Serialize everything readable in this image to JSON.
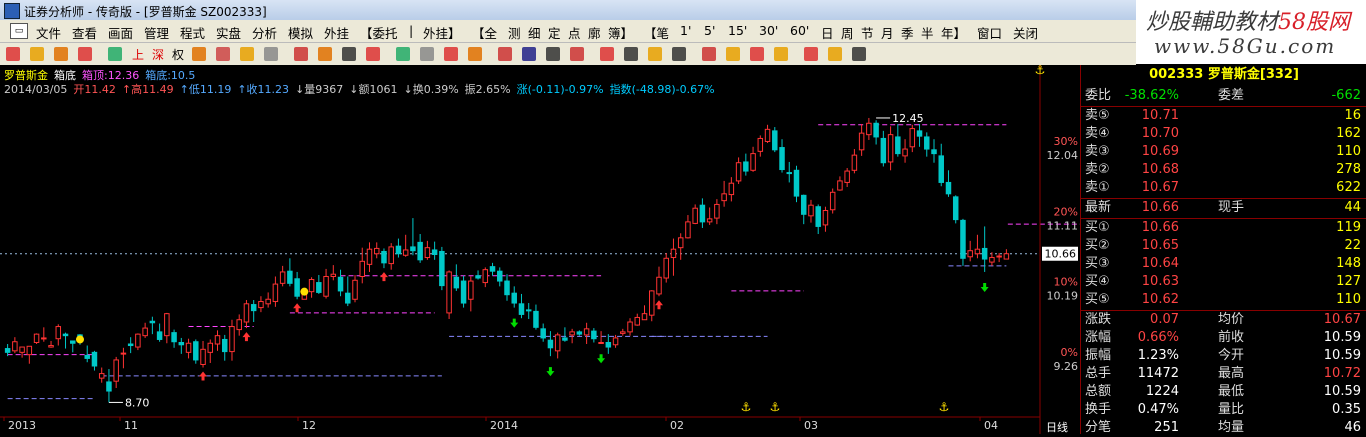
{
  "window": {
    "title": "证券分析师 - 传奇版 - [罗普斯金 SZ002333]"
  },
  "brand": {
    "text_a": "炒股輔助教材",
    "text_b": "58股网",
    "url": "www.58Gu.com"
  },
  "menu": [
    "文件",
    "查看",
    "画面",
    "管理",
    "程式",
    "实盘",
    "分析",
    "模拟",
    "外挂",
    "【委托",
    "|",
    "外挂】",
    "【全",
    "测",
    "细",
    "定",
    "点",
    "廓",
    "簿】",
    "【笔",
    "1'",
    "5'",
    "15'",
    "30'",
    "60'",
    "日",
    "周",
    "节",
    "月",
    "季",
    "半",
    "年】",
    "窗口",
    "关闭"
  ],
  "toolbar": {
    "labels": [
      "上",
      "深",
      "权"
    ]
  },
  "info": {
    "line1": [
      {
        "t": "罗普斯金",
        "c": "#ffff00"
      },
      {
        "t": "箱底",
        "c": "#ffffff"
      },
      {
        "t": "箱顶:12.36",
        "c": "#ff55ff"
      },
      {
        "t": "箱底:10.5",
        "c": "#55aaff"
      }
    ],
    "line2": [
      {
        "t": "2014/03/05",
        "c": "#cccccc"
      },
      {
        "t": "开11.42",
        "c": "#ff5555"
      },
      {
        "t": "↑高11.49",
        "c": "#ff5555"
      },
      {
        "t": "↑低11.19",
        "c": "#55aaff"
      },
      {
        "t": "↑收11.23",
        "c": "#55aaff"
      },
      {
        "t": "↓量9367",
        "c": "#cccccc"
      },
      {
        "t": "↓额1061",
        "c": "#cccccc"
      },
      {
        "t": "↓换0.39%",
        "c": "#cccccc"
      },
      {
        "t": "振2.65%",
        "c": "#cccccc"
      },
      {
        "t": "涨(-0.11)-0.97%",
        "c": "#00ccff"
      },
      {
        "t": "指数(-48.98)-0.67%",
        "c": "#00ccff"
      }
    ]
  },
  "axis": {
    "right_labels": [
      {
        "pct": "30%",
        "price": "12.04"
      },
      {
        "pct": "20%",
        "price": "11.11"
      },
      {
        "pct": "10%",
        "price": "10.19"
      },
      {
        "pct": "0%",
        "price": "9.26"
      }
    ],
    "current_price": "10.66",
    "high_label": "12.45",
    "low_label": "8.70",
    "x_labels": [
      {
        "t": "2013",
        "x": 4
      },
      {
        "t": "11",
        "x": 120
      },
      {
        "t": "12",
        "x": 298
      },
      {
        "t": "2014",
        "x": 486
      },
      {
        "t": "02",
        "x": 666
      },
      {
        "t": "03",
        "x": 800
      },
      {
        "t": "04",
        "x": 980
      }
    ],
    "period": "日线"
  },
  "quote": {
    "header": "002333 罗普斯金[332]",
    "weibi": {
      "l": "委比",
      "v": "-38.62%",
      "l2": "委差",
      "v2": "-662"
    },
    "asks": [
      {
        "l": "卖⑤",
        "p": "10.71",
        "v": "16"
      },
      {
        "l": "卖④",
        "p": "10.70",
        "v": "162"
      },
      {
        "l": "卖③",
        "p": "10.69",
        "v": "110"
      },
      {
        "l": "卖②",
        "p": "10.68",
        "v": "278"
      },
      {
        "l": "卖①",
        "p": "10.67",
        "v": "622"
      }
    ],
    "last": {
      "l": "最新",
      "p": "10.66",
      "l2": "现手",
      "v": "44"
    },
    "bids": [
      {
        "l": "买①",
        "p": "10.66",
        "v": "119"
      },
      {
        "l": "买②",
        "p": "10.65",
        "v": "22"
      },
      {
        "l": "买③",
        "p": "10.64",
        "v": "148"
      },
      {
        "l": "买④",
        "p": "10.63",
        "v": "127"
      },
      {
        "l": "买⑤",
        "p": "10.62",
        "v": "110"
      }
    ],
    "stats": [
      {
        "l": "涨跌",
        "v": "0.07",
        "vc": "red",
        "l2": "均价",
        "v2": "10.67",
        "v2c": "red"
      },
      {
        "l": "涨幅",
        "v": "0.66%",
        "vc": "red",
        "l2": "前收",
        "v2": "10.59",
        "v2c": "wht"
      },
      {
        "l": "振幅",
        "v": "1.23%",
        "vc": "wht",
        "l2": "今开",
        "v2": "10.59",
        "v2c": "wht"
      },
      {
        "l": "总手",
        "v": "11472",
        "vc": "wht",
        "l2": "最高",
        "v2": "10.72",
        "v2c": "red"
      },
      {
        "l": "总额",
        "v": "1224",
        "vc": "wht",
        "l2": "最低",
        "v2": "10.59",
        "v2c": "wht"
      },
      {
        "l": "换手",
        "v": "0.47%",
        "vc": "wht",
        "l2": "量比",
        "v2": "0.35",
        "v2c": "wht"
      },
      {
        "l": "分笔",
        "v": "251",
        "vc": "wht",
        "l2": "均量",
        "v2": "46",
        "v2c": "wht"
      }
    ]
  },
  "colors": {
    "up": "#ff3333",
    "down": "#00c8c8",
    "box_top": "#ff44ff",
    "box_bottom": "#8888ff"
  },
  "chart_data": {
    "type": "candlestick",
    "y_range": [
      8.6,
      12.7
    ],
    "candles": [
      [
        9.41,
        9.47,
        9.31,
        9.36
      ],
      [
        9.38,
        9.56,
        9.35,
        9.5
      ],
      [
        9.36,
        9.43,
        9.29,
        9.43
      ],
      [
        9.33,
        9.44,
        9.21,
        9.44
      ],
      [
        9.49,
        9.61,
        9.47,
        9.6
      ],
      [
        9.54,
        9.69,
        9.5,
        9.55
      ],
      [
        9.43,
        9.51,
        9.42,
        9.45
      ],
      [
        9.54,
        9.73,
        9.45,
        9.7
      ],
      [
        9.6,
        9.62,
        9.41,
        9.58
      ],
      [
        9.51,
        9.51,
        9.36,
        9.48
      ],
      [
        9.59,
        9.6,
        9.46,
        9.53
      ],
      [
        9.32,
        9.45,
        9.23,
        9.28
      ],
      [
        9.36,
        9.38,
        9.12,
        9.18
      ],
      [
        9.02,
        9.16,
        8.96,
        9.08
      ],
      [
        8.97,
        9.14,
        8.7,
        8.85
      ],
      [
        8.98,
        9.3,
        8.89,
        9.26
      ],
      [
        9.34,
        9.42,
        9.15,
        9.35
      ],
      [
        9.47,
        9.56,
        9.35,
        9.45
      ],
      [
        9.43,
        9.61,
        9.39,
        9.6
      ],
      [
        9.58,
        9.75,
        9.55,
        9.68
      ],
      [
        9.77,
        9.83,
        9.6,
        9.75
      ],
      [
        9.63,
        9.74,
        9.5,
        9.53
      ],
      [
        9.58,
        9.88,
        9.48,
        9.87
      ],
      [
        9.62,
        9.66,
        9.42,
        9.5
      ],
      [
        9.49,
        9.55,
        9.34,
        9.46
      ],
      [
        9.36,
        9.54,
        9.28,
        9.48
      ],
      [
        9.5,
        9.53,
        9.21,
        9.26
      ],
      [
        9.2,
        9.51,
        9.16,
        9.4
      ],
      [
        9.36,
        9.53,
        9.22,
        9.48
      ],
      [
        9.47,
        9.65,
        9.38,
        9.58
      ],
      [
        9.53,
        9.59,
        9.25,
        9.37
      ],
      [
        9.37,
        9.79,
        9.25,
        9.7
      ],
      [
        9.66,
        9.86,
        9.58,
        9.79
      ],
      [
        9.76,
        10.05,
        9.68,
        10.0
      ],
      [
        9.99,
        10.05,
        9.76,
        9.91
      ],
      [
        9.95,
        10.1,
        9.89,
        10.03
      ],
      [
        10.0,
        10.15,
        9.95,
        10.06
      ],
      [
        10.03,
        10.36,
        9.96,
        10.26
      ],
      [
        10.27,
        10.5,
        10.23,
        10.42
      ],
      [
        10.43,
        10.6,
        10.23,
        10.27
      ],
      [
        10.33,
        10.42,
        10.06,
        10.1
      ],
      [
        10.06,
        10.19,
        10.06,
        10.16
      ],
      [
        10.16,
        10.35,
        10.08,
        10.32
      ],
      [
        10.28,
        10.38,
        10.13,
        10.15
      ],
      [
        10.1,
        10.46,
        10.07,
        10.36
      ],
      [
        10.36,
        10.51,
        10.31,
        10.39
      ],
      [
        10.35,
        10.45,
        10.1,
        10.17
      ],
      [
        10.14,
        10.36,
        9.97,
        10.01
      ],
      [
        10.06,
        10.38,
        10.02,
        10.31
      ],
      [
        10.36,
        10.74,
        10.27,
        10.56
      ],
      [
        10.52,
        10.81,
        10.42,
        10.72
      ],
      [
        10.66,
        10.81,
        10.6,
        10.73
      ],
      [
        10.69,
        10.73,
        10.47,
        10.54
      ],
      [
        10.53,
        10.8,
        10.45,
        10.75
      ],
      [
        10.76,
        10.86,
        10.61,
        10.66
      ],
      [
        10.64,
        10.91,
        10.62,
        10.71
      ],
      [
        10.75,
        11.13,
        10.64,
        10.7
      ],
      [
        10.81,
        10.92,
        10.54,
        10.58
      ],
      [
        10.61,
        10.83,
        10.58,
        10.74
      ],
      [
        10.71,
        10.82,
        10.58,
        10.65
      ],
      [
        10.69,
        10.75,
        10.18,
        10.24
      ],
      [
        9.88,
        10.44,
        9.8,
        10.42
      ],
      [
        10.35,
        10.52,
        10.17,
        10.21
      ],
      [
        10.3,
        10.37,
        9.95,
        10.01
      ],
      [
        10.06,
        10.36,
        9.9,
        10.3
      ],
      [
        10.37,
        10.44,
        10.32,
        10.34
      ],
      [
        10.28,
        10.48,
        10.22,
        10.45
      ],
      [
        10.49,
        10.54,
        10.37,
        10.43
      ],
      [
        10.43,
        10.48,
        10.23,
        10.3
      ],
      [
        10.3,
        10.39,
        10.04,
        10.12
      ],
      [
        10.14,
        10.23,
        9.95,
        10.01
      ],
      [
        10.0,
        10.13,
        9.81,
        9.86
      ],
      [
        9.92,
        10.01,
        9.8,
        9.91
      ],
      [
        9.9,
        9.99,
        9.66,
        9.69
      ],
      [
        9.67,
        9.74,
        9.5,
        9.55
      ],
      [
        9.52,
        9.64,
        9.31,
        9.42
      ],
      [
        9.38,
        9.62,
        9.28,
        9.59
      ],
      [
        9.55,
        9.69,
        9.5,
        9.52
      ],
      [
        9.59,
        9.67,
        9.48,
        9.63
      ],
      [
        9.63,
        9.65,
        9.58,
        9.6
      ],
      [
        9.59,
        9.75,
        9.47,
        9.67
      ],
      [
        9.64,
        9.68,
        9.49,
        9.54
      ],
      [
        9.49,
        9.64,
        9.48,
        9.49
      ],
      [
        9.49,
        9.6,
        9.34,
        9.43
      ],
      [
        9.46,
        9.59,
        9.42,
        9.55
      ],
      [
        9.61,
        9.67,
        9.58,
        9.63
      ],
      [
        9.63,
        9.81,
        9.58,
        9.76
      ],
      [
        9.72,
        9.87,
        9.71,
        9.82
      ],
      [
        9.79,
        9.98,
        9.79,
        9.87
      ],
      [
        9.85,
        10.18,
        9.77,
        10.17
      ],
      [
        10.13,
        10.49,
        10.1,
        10.35
      ],
      [
        10.34,
        10.67,
        10.28,
        10.6
      ],
      [
        10.61,
        10.86,
        10.37,
        10.72
      ],
      [
        10.74,
        10.93,
        10.58,
        10.87
      ],
      [
        10.87,
        11.17,
        10.86,
        11.08
      ],
      [
        11.06,
        11.31,
        11.05,
        11.26
      ],
      [
        11.3,
        11.39,
        11.0,
        11.08
      ],
      [
        11.08,
        11.27,
        11.04,
        11.12
      ],
      [
        11.13,
        11.38,
        11.05,
        11.31
      ],
      [
        11.36,
        11.62,
        11.28,
        11.45
      ],
      [
        11.44,
        11.67,
        11.35,
        11.59
      ],
      [
        11.62,
        11.93,
        11.58,
        11.86
      ],
      [
        11.87,
        11.98,
        11.69,
        11.75
      ],
      [
        11.76,
        12.07,
        11.74,
        11.98
      ],
      [
        12.01,
        12.22,
        11.94,
        12.18
      ],
      [
        12.14,
        12.36,
        12.12,
        12.3
      ],
      [
        12.28,
        12.33,
        12.0,
        12.03
      ],
      [
        12.06,
        12.17,
        11.73,
        11.77
      ],
      [
        11.73,
        11.87,
        11.6,
        11.72
      ],
      [
        11.76,
        11.82,
        11.34,
        11.42
      ],
      [
        11.43,
        11.44,
        11.05,
        11.18
      ],
      [
        11.16,
        11.37,
        11.07,
        11.3
      ],
      [
        11.28,
        11.31,
        10.92,
        11.02
      ],
      [
        11.04,
        11.28,
        10.95,
        11.23
      ],
      [
        11.24,
        11.52,
        11.19,
        11.47
      ],
      [
        11.5,
        11.68,
        11.49,
        11.62
      ],
      [
        11.6,
        11.79,
        11.54,
        11.75
      ],
      [
        11.76,
        12.04,
        11.72,
        11.96
      ],
      [
        12.03,
        12.37,
        11.95,
        12.25
      ],
      [
        12.23,
        12.45,
        12.16,
        12.38
      ],
      [
        12.38,
        12.42,
        12.1,
        12.2
      ],
      [
        12.18,
        12.28,
        11.81,
        11.86
      ],
      [
        11.87,
        12.34,
        11.76,
        12.23
      ],
      [
        12.2,
        12.37,
        11.94,
        11.98
      ],
      [
        11.95,
        12.17,
        11.86,
        12.04
      ],
      [
        12.07,
        12.36,
        12.0,
        12.31
      ],
      [
        12.28,
        12.37,
        12.07,
        12.21
      ],
      [
        12.2,
        12.26,
        11.94,
        12.04
      ],
      [
        12.03,
        12.17,
        11.86,
        11.98
      ],
      [
        11.95,
        12.11,
        11.55,
        11.6
      ],
      [
        11.6,
        11.76,
        11.41,
        11.45
      ],
      [
        11.41,
        11.43,
        11.06,
        11.11
      ],
      [
        11.1,
        11.12,
        10.5,
        10.6
      ],
      [
        10.62,
        10.83,
        10.56,
        10.7
      ],
      [
        10.66,
        10.91,
        10.6,
        10.72
      ],
      [
        10.73,
        11.02,
        10.42,
        10.59
      ],
      [
        10.55,
        10.68,
        10.5,
        10.61
      ],
      [
        10.62,
        10.67,
        10.55,
        10.63
      ],
      [
        10.59,
        10.72,
        10.59,
        10.66
      ]
    ],
    "box_segments": [
      {
        "x0": 0,
        "x1": 12,
        "y": 9.33,
        "kind": "bottom_magenta"
      },
      {
        "x0": 25,
        "x1": 34,
        "y": 9.7,
        "kind": "top_magenta"
      },
      {
        "x0": 13,
        "x1": 60,
        "y": 9.05,
        "kind": "bottom_blue"
      },
      {
        "x0": 39,
        "x1": 59,
        "y": 9.88,
        "kind": "top_magenta"
      },
      {
        "x0": 46,
        "x1": 82,
        "y": 10.37,
        "kind": "top_magenta"
      },
      {
        "x0": 0,
        "x1": 12,
        "y": 8.75,
        "kind": "bottom_blue"
      },
      {
        "x0": 61,
        "x1": 91,
        "y": 9.57,
        "kind": "bottom_blue"
      },
      {
        "x0": 89,
        "x1": 105,
        "y": 9.57,
        "kind": "bottom_blue"
      },
      {
        "x0": 100,
        "x1": 110,
        "y": 10.17,
        "kind": "top_magenta"
      },
      {
        "x0": 112,
        "x1": 161,
        "y": 12.36,
        "kind": "top_magenta"
      },
      {
        "x0": 130,
        "x1": 160,
        "y": 10.5,
        "kind": "bottom_blue"
      },
      {
        "x0": 161,
        "x1": 171,
        "y": 11.05,
        "kind": "top_magenta"
      }
    ],
    "dashed_y": 10.66
  }
}
